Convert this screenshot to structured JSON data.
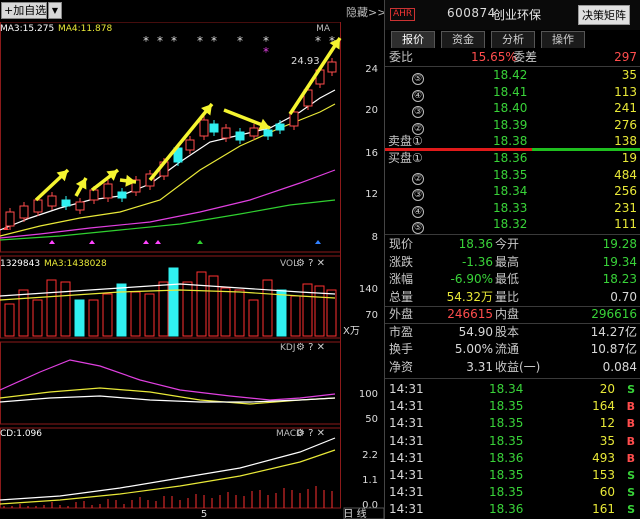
{
  "toolbar": {
    "add_label": "+加自选",
    "dropdown_icon": "triangle-down-icon",
    "hide_label": "隐藏>>"
  },
  "indicators": {
    "ma3": "MA3:15.275",
    "ma4": "MA4:11.878",
    "ma_label": "MA",
    "price_high": "24.93",
    "price_axis": [
      "24",
      "20",
      "16",
      "12",
      "8"
    ],
    "vol_ma2": "1329843",
    "vol_ma3": "MA3:1438028",
    "vol_label": "VOL",
    "vol_axis": [
      "140",
      "70"
    ],
    "vol_unit": "X万",
    "kdj_label": "KDJ",
    "kdj_axis": [
      "100",
      "50"
    ],
    "macd_value": "CD:1.096",
    "macd_label": "MACD",
    "macd_axis": [
      "2.2",
      "1.1",
      "0.0"
    ],
    "date_label": "5",
    "period_label": "日 线"
  },
  "header": {
    "badge": "AHR",
    "code": "600874",
    "name": "创业环保",
    "decision_button": "决策矩阵"
  },
  "tabs": [
    "报价",
    "资金",
    "分析",
    "操作"
  ],
  "weibi": {
    "label": "委比",
    "value": "15.65%",
    "diff_label": "委差",
    "diff_value": "297"
  },
  "sell_orders": [
    {
      "level": "⑤",
      "price": "18.42",
      "volume": "35"
    },
    {
      "level": "④",
      "price": "18.41",
      "volume": "113"
    },
    {
      "level": "③",
      "price": "18.40",
      "volume": "241"
    },
    {
      "level": "②",
      "price": "18.39",
      "volume": "276"
    },
    {
      "level": "卖盘①",
      "price": "18.38",
      "volume": "138"
    }
  ],
  "buy_orders": [
    {
      "level": "买盘①",
      "price": "18.36",
      "volume": "19"
    },
    {
      "level": "②",
      "price": "18.35",
      "volume": "484"
    },
    {
      "level": "③",
      "price": "18.34",
      "volume": "256"
    },
    {
      "level": "④",
      "price": "18.33",
      "volume": "231"
    },
    {
      "level": "⑤",
      "price": "18.32",
      "volume": "111"
    }
  ],
  "stats": [
    {
      "l1": "现价",
      "v1": "18.36",
      "c1": "g",
      "l2": "今开",
      "v2": "19.28",
      "c2": "g"
    },
    {
      "l1": "涨跌",
      "v1": "-1.36",
      "c1": "g",
      "l2": "最高",
      "v2": "19.34",
      "c2": "g"
    },
    {
      "l1": "涨幅",
      "v1": "-6.90%",
      "c1": "g",
      "l2": "最低",
      "v2": "18.23",
      "c2": "g"
    },
    {
      "l1": "总量",
      "v1": "54.32万",
      "c1": "y",
      "l2": "量比",
      "v2": "0.70",
      "c2": "w"
    },
    {
      "l1": "外盘",
      "v1": "246615",
      "c1": "r",
      "l2": "内盘",
      "v2": "296616",
      "c2": "g"
    },
    {
      "l1": "市盈",
      "v1": "54.90",
      "c1": "w",
      "l2": "股本",
      "v2": "14.27亿",
      "c2": "w"
    },
    {
      "l1": "换手",
      "v1": "5.00%",
      "c1": "w",
      "l2": "流通",
      "v2": "10.87亿",
      "c2": "w"
    },
    {
      "l1": "净资",
      "v1": "3.31",
      "c1": "w",
      "l2": "收益(一)",
      "v2": "0.084",
      "c2": "w"
    }
  ],
  "ticks": [
    {
      "time": "14:31",
      "price": "18.34",
      "vol": "20",
      "side": "S"
    },
    {
      "time": "14:31",
      "price": "18.35",
      "vol": "164",
      "side": "B"
    },
    {
      "time": "14:31",
      "price": "18.35",
      "vol": "12",
      "side": "B"
    },
    {
      "time": "14:31",
      "price": "18.35",
      "vol": "35",
      "side": "B"
    },
    {
      "time": "14:31",
      "price": "18.36",
      "vol": "493",
      "side": "B"
    },
    {
      "time": "14:31",
      "price": "18.35",
      "vol": "153",
      "side": "S"
    },
    {
      "time": "14:31",
      "price": "18.35",
      "vol": "60",
      "side": "S"
    },
    {
      "time": "14:31",
      "price": "18.36",
      "vol": "161",
      "side": "S"
    }
  ],
  "colors": {
    "up": "#ff4d4d",
    "down": "#39d339",
    "vol_up": "#ff3030",
    "vol_down": "#30f0f0",
    "arrow": "#f5f530",
    "ma_white": "#ffffff",
    "ma_yellow": "#e8e838",
    "ma_magenta": "#e040e0",
    "ma_green": "#30d030"
  }
}
